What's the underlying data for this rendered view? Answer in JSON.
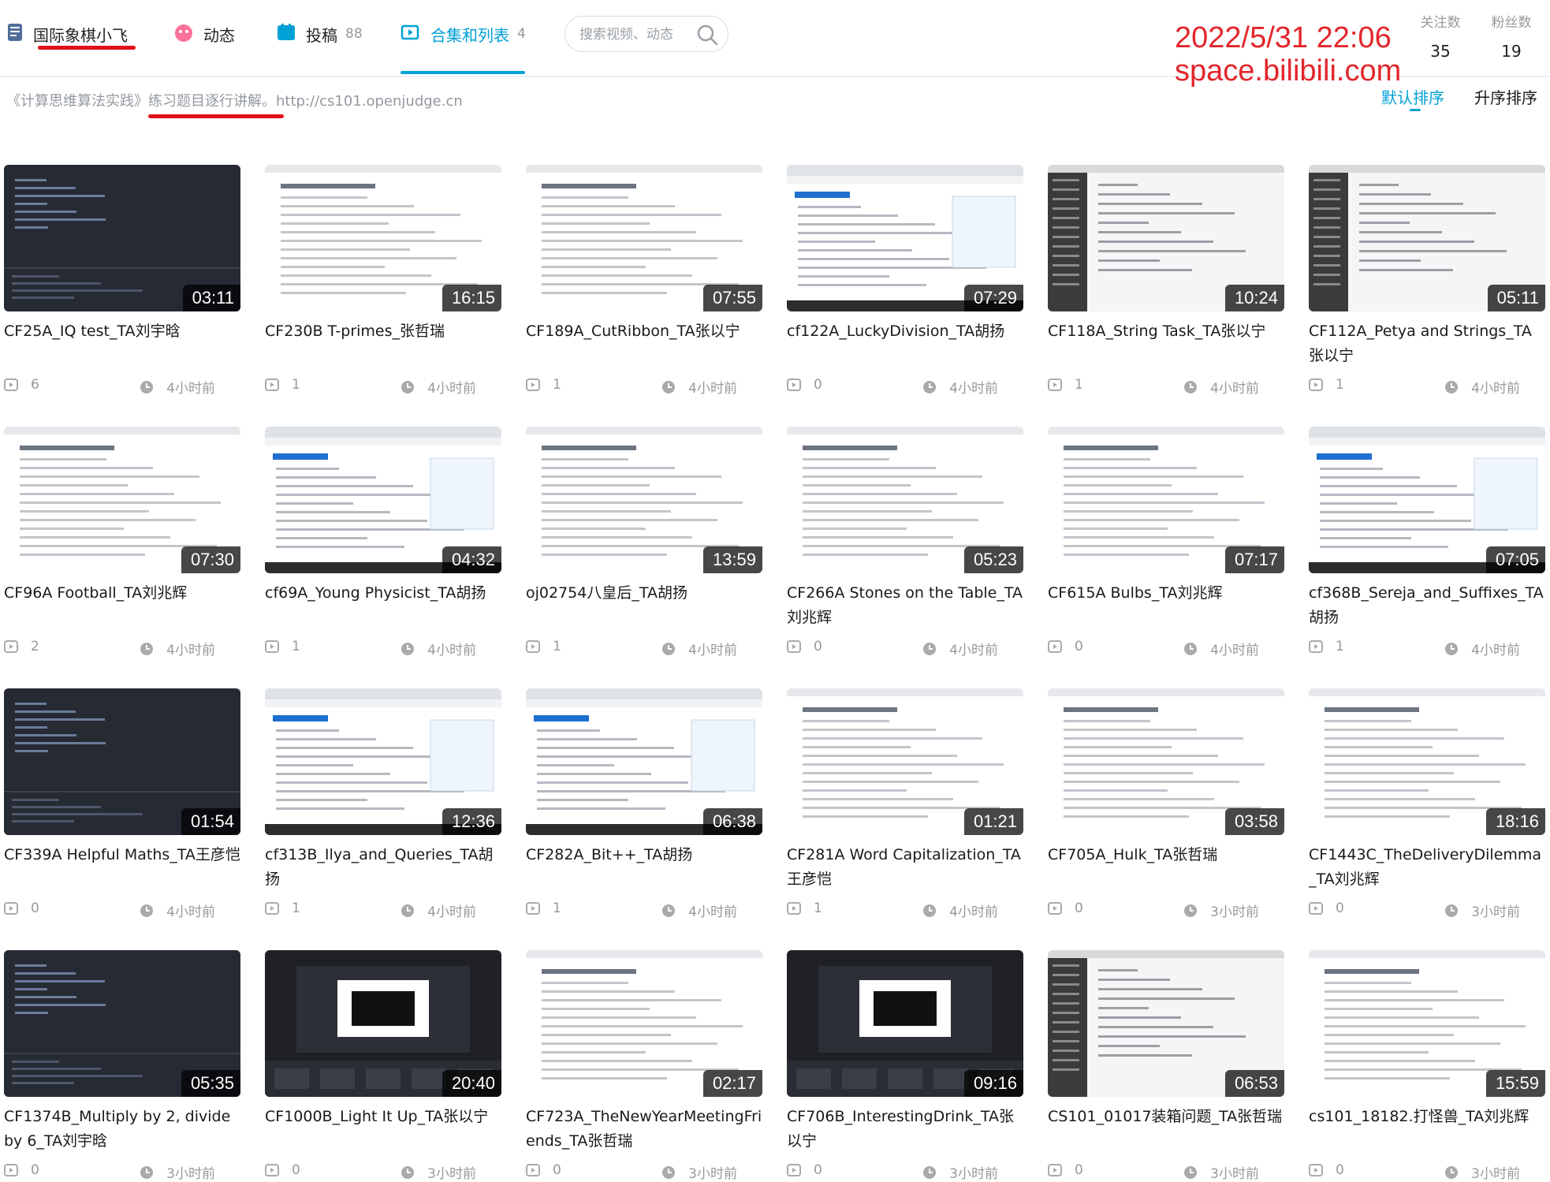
{
  "nav": {
    "username": "国际象棋小飞",
    "dynamic": "动态",
    "submissions": "投稿",
    "submissions_count": "88",
    "collections": "合集和列表",
    "collections_count": "4",
    "search_placeholder": "搜索视频、动态"
  },
  "watermark": {
    "datetime": "2022/5/31 22:06",
    "site": "space.bilibili.com"
  },
  "stats": {
    "following_label": "关注数",
    "following": "35",
    "fans_label": "粉丝数",
    "fans": "19"
  },
  "description": "《计算思维算法实践》练习题目逐行讲解。http://cs101.openjudge.cn",
  "sort": {
    "default": "默认排序",
    "ascending": "升序排序"
  },
  "colors": {
    "accent": "#00a1d6",
    "annotation_red": "#e1101a"
  },
  "videos": [
    {
      "title": "CF25A_IQ test_TA刘宇晗",
      "duration": "03:11",
      "plays": "6",
      "time": "4小时前",
      "theme": "dark"
    },
    {
      "title": "CF230B T-primes_张哲瑞",
      "duration": "16:15",
      "plays": "1",
      "time": "4小时前",
      "theme": "doc"
    },
    {
      "title": "CF189A_CutRibbon_TA张以宁",
      "duration": "07:55",
      "plays": "1",
      "time": "4小时前",
      "theme": "doc"
    },
    {
      "title": "cf122A_LuckyDivision_TA胡扬",
      "duration": "07:29",
      "plays": "0",
      "time": "4小时前",
      "theme": "browser"
    },
    {
      "title": "CF118A_String Task_TA张以宁",
      "duration": "10:24",
      "plays": "1",
      "time": "4小时前",
      "theme": "ide"
    },
    {
      "title": "CF112A_Petya and Strings_TA张以宁",
      "duration": "05:11",
      "plays": "1",
      "time": "4小时前",
      "theme": "ide"
    },
    {
      "title": "CF96A Football_TA刘兆辉",
      "duration": "07:30",
      "plays": "2",
      "time": "4小时前",
      "theme": "doc"
    },
    {
      "title": "cf69A_Young Physicist_TA胡扬",
      "duration": "04:32",
      "plays": "1",
      "time": "4小时前",
      "theme": "browser"
    },
    {
      "title": "oj02754八皇后_TA胡扬",
      "duration": "13:59",
      "plays": "1",
      "time": "4小时前",
      "theme": "doc"
    },
    {
      "title": "CF266A Stones on the Table_TA刘兆辉",
      "duration": "05:23",
      "plays": "0",
      "time": "4小时前",
      "theme": "doc"
    },
    {
      "title": "CF615A Bulbs_TA刘兆辉",
      "duration": "07:17",
      "plays": "0",
      "time": "4小时前",
      "theme": "doc"
    },
    {
      "title": "cf368B_Sereja_and_Suffixes_TA胡扬",
      "duration": "07:05",
      "plays": "1",
      "time": "4小时前",
      "theme": "browser"
    },
    {
      "title": "CF339A Helpful Maths_TA王彦恺",
      "duration": "01:54",
      "plays": "0",
      "time": "4小时前",
      "theme": "dark"
    },
    {
      "title": "cf313B_Ilya_and_Queries_TA胡扬",
      "duration": "12:36",
      "plays": "1",
      "time": "4小时前",
      "theme": "browser"
    },
    {
      "title": "CF282A_Bit++_TA胡扬",
      "duration": "06:38",
      "plays": "1",
      "time": "4小时前",
      "theme": "browser"
    },
    {
      "title": "CF281A Word Capitalization_TA王彦恺",
      "duration": "01:21",
      "plays": "1",
      "time": "4小时前",
      "theme": "doc"
    },
    {
      "title": "CF705A_Hulk_TA张哲瑞",
      "duration": "03:58",
      "plays": "0",
      "time": "3小时前",
      "theme": "doc"
    },
    {
      "title": "CF1443C_TheDeliveryDilemma_TA刘兆辉",
      "duration": "18:16",
      "plays": "0",
      "time": "3小时前",
      "theme": "doc"
    },
    {
      "title": "CF1374B_Multiply by 2, divide by 6_TA刘宇晗",
      "duration": "05:35",
      "plays": "0",
      "time": "3小时前",
      "theme": "dark"
    },
    {
      "title": "CF1000B_Light It Up_TA张以宁",
      "duration": "20:40",
      "plays": "0",
      "time": "3小时前",
      "theme": "obs"
    },
    {
      "title": "CF723A_TheNewYearMeetingFriends_TA张哲瑞",
      "duration": "02:17",
      "plays": "0",
      "time": "3小时前",
      "theme": "doc"
    },
    {
      "title": "CF706B_InterestingDrink_TA张以宁",
      "duration": "09:16",
      "plays": "0",
      "time": "3小时前",
      "theme": "obs"
    },
    {
      "title": "CS101_01017装箱问题_TA张哲瑞",
      "duration": "06:53",
      "plays": "0",
      "time": "3小时前",
      "theme": "ide"
    },
    {
      "title": "cs101_18182.打怪兽_TA刘兆辉",
      "duration": "15:59",
      "plays": "0",
      "time": "3小时前",
      "theme": "doc"
    }
  ]
}
